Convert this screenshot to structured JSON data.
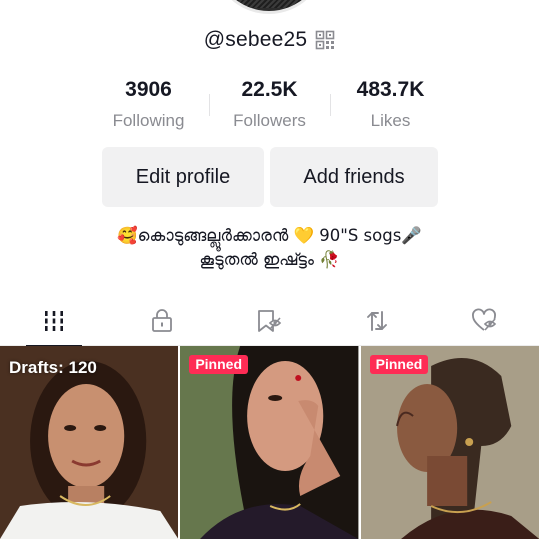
{
  "profile": {
    "username": "@sebee25",
    "stats": [
      {
        "value": "3906",
        "label": "Following"
      },
      {
        "value": "22.5K",
        "label": "Followers"
      },
      {
        "value": "483.7K",
        "label": "Likes"
      }
    ],
    "buttons": {
      "edit": "Edit profile",
      "add_friends": "Add friends"
    },
    "bio_lines": [
      "🥰കൊടുങ്ങല്ലൂർക്കാരൻ 💛 90\"S sogs🎤",
      "കൂടുതൽ ഇഷ്ട്ടം 🥀"
    ]
  },
  "tabs": [
    {
      "icon": "videos-grid-icon",
      "active": true
    },
    {
      "icon": "lock-icon",
      "active": false
    },
    {
      "icon": "bookmark-icon",
      "active": false
    },
    {
      "icon": "repost-icon",
      "active": false
    },
    {
      "icon": "liked-hidden-icon",
      "active": false
    }
  ],
  "videos": [
    {
      "overlay": "Drafts: 120"
    },
    {
      "badge": "Pinned"
    },
    {
      "badge": "Pinned"
    }
  ],
  "colors": {
    "accent_red": "#fe2c55",
    "text_primary": "#161823",
    "text_secondary": "#8a8b91",
    "button_bg": "#f1f1f2"
  }
}
